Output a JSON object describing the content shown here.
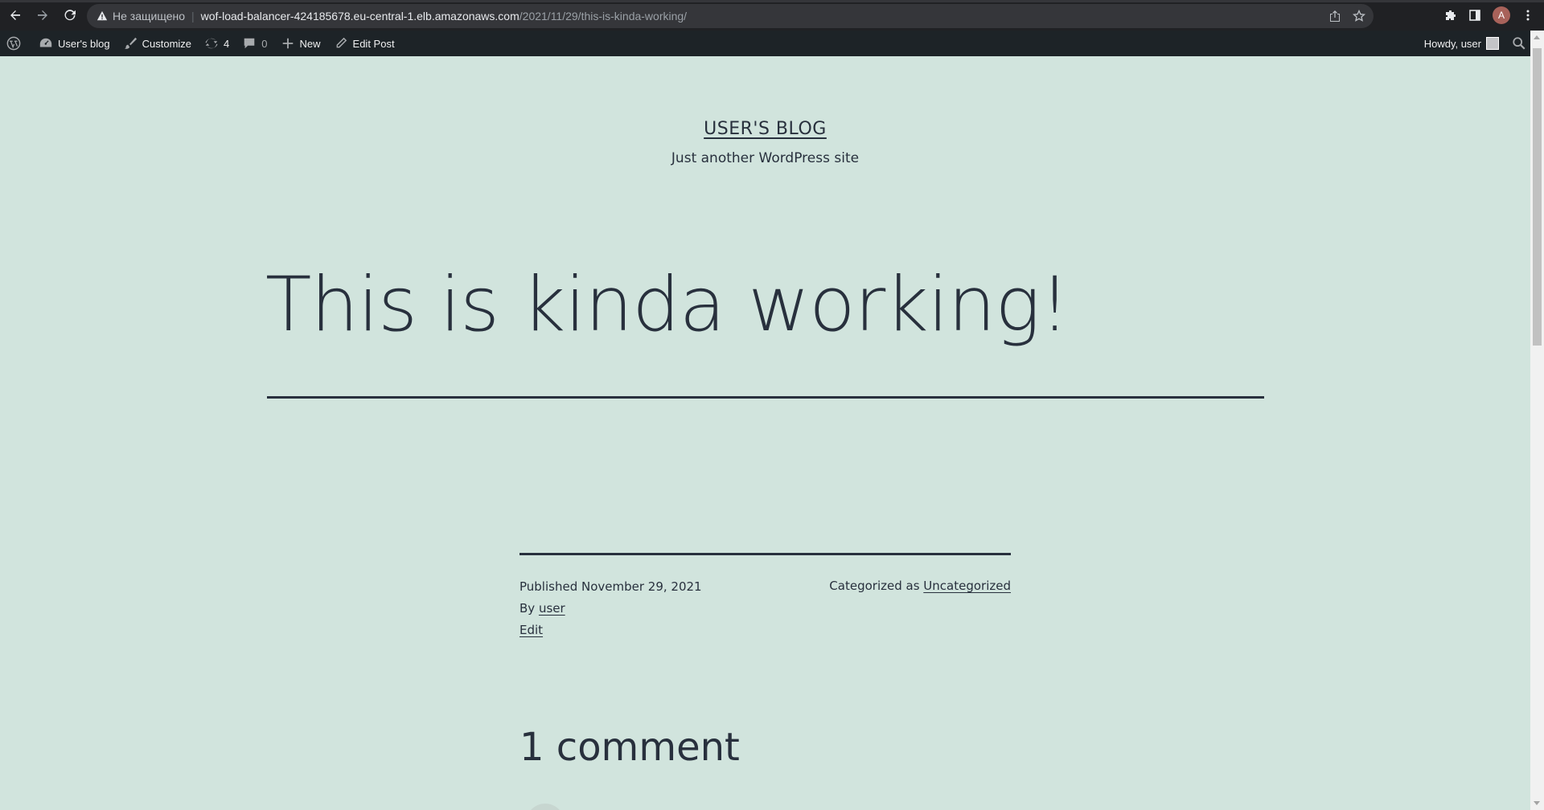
{
  "browser": {
    "security_label": "Не защищено",
    "url_host": "wof-load-balancer-424185678.eu-central-1.elb.amazonaws.com",
    "url_path": "/2021/11/29/this-is-kinda-working/",
    "profile_initial": "A"
  },
  "admin_bar": {
    "site_name": "User's blog",
    "customize": "Customize",
    "updates_count": "4",
    "comments_count": "0",
    "new": "New",
    "edit_post": "Edit Post",
    "howdy": "Howdy, user"
  },
  "site": {
    "title": "USER'S BLOG",
    "description": "Just another WordPress site"
  },
  "post": {
    "title": "This is kinda working!",
    "published_label": "Published",
    "published_date": "November 29, 2021",
    "by_label": "By",
    "author": "user",
    "edit_link": "Edit",
    "categorized_label": "Categorized as",
    "category": "Uncategorized"
  },
  "comments": {
    "title": "1 comment"
  },
  "colors": {
    "background": "#d1e4dd",
    "text": "#28303d",
    "admin_bar": "#1d2327",
    "browser_bar": "#202124"
  }
}
